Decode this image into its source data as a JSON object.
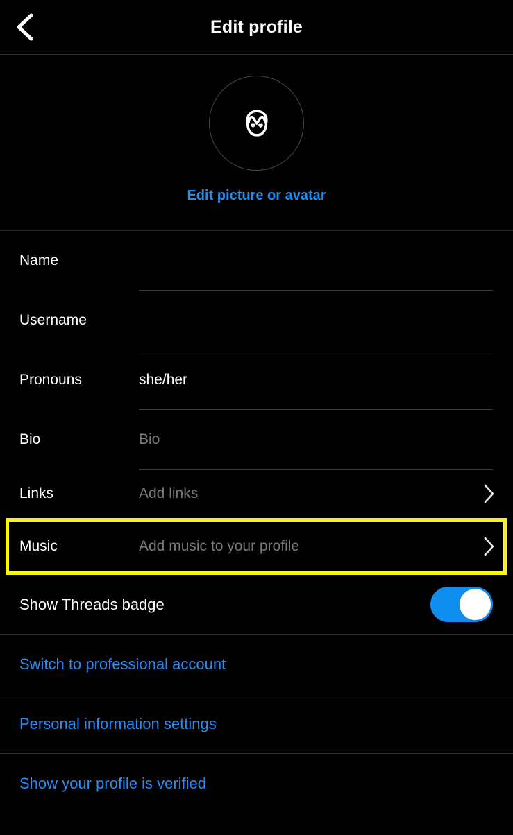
{
  "header": {
    "back_icon": "chevron-left-icon",
    "title": "Edit profile"
  },
  "avatar": {
    "icon": "avatar-face-heart-eyes-icon",
    "edit_link": "Edit picture or avatar"
  },
  "fields": [
    {
      "label": "Name",
      "value": "",
      "placeholder": ""
    },
    {
      "label": "Username",
      "value": "",
      "placeholder": ""
    },
    {
      "label": "Pronouns",
      "value": "she/her",
      "placeholder": ""
    },
    {
      "label": "Bio",
      "value": "",
      "placeholder": "Bio"
    }
  ],
  "nav_rows": [
    {
      "label": "Links",
      "placeholder": "Add links",
      "chevron": "chevron-right-icon",
      "highlighted": false
    },
    {
      "label": "Music",
      "placeholder": "Add music to your profile",
      "chevron": "chevron-right-icon",
      "highlighted": true
    }
  ],
  "toggle_row": {
    "label": "Show Threads badge",
    "state": "on"
  },
  "actions": [
    {
      "label": "Switch to professional account"
    },
    {
      "label": "Personal information settings"
    },
    {
      "label": "Show your profile is verified"
    }
  ],
  "colors": {
    "background": "#000000",
    "link_blue": "#2a8bf2",
    "toggle_on": "#0f8ef0",
    "highlight_yellow": "#fbf315",
    "placeholder_gray": "#7a7a7a",
    "divider": "#2b2b2b"
  }
}
